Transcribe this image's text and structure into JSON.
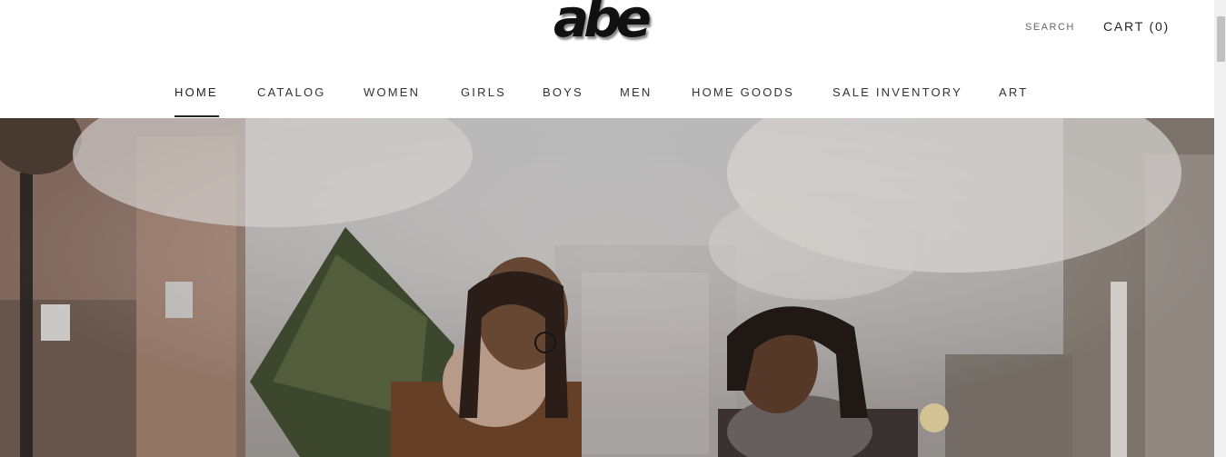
{
  "brand": {
    "logo_text": "abe"
  },
  "header": {
    "search_label": "SEARCH",
    "cart_label": "CART (0)"
  },
  "nav": {
    "items": [
      {
        "label": "HOME",
        "active": true
      },
      {
        "label": "CATALOG"
      },
      {
        "label": "WOMEN"
      },
      {
        "label": "GIRLS"
      },
      {
        "label": "BOYS"
      },
      {
        "label": "MEN"
      },
      {
        "label": "HOME GOODS"
      },
      {
        "label": "SALE INVENTORY"
      },
      {
        "label": "ART"
      }
    ]
  },
  "hero": {
    "image": "winter-street-couple-with-christmas-tree"
  },
  "colors": {
    "text": "#222222",
    "muted": "#666666",
    "background": "#ffffff"
  }
}
